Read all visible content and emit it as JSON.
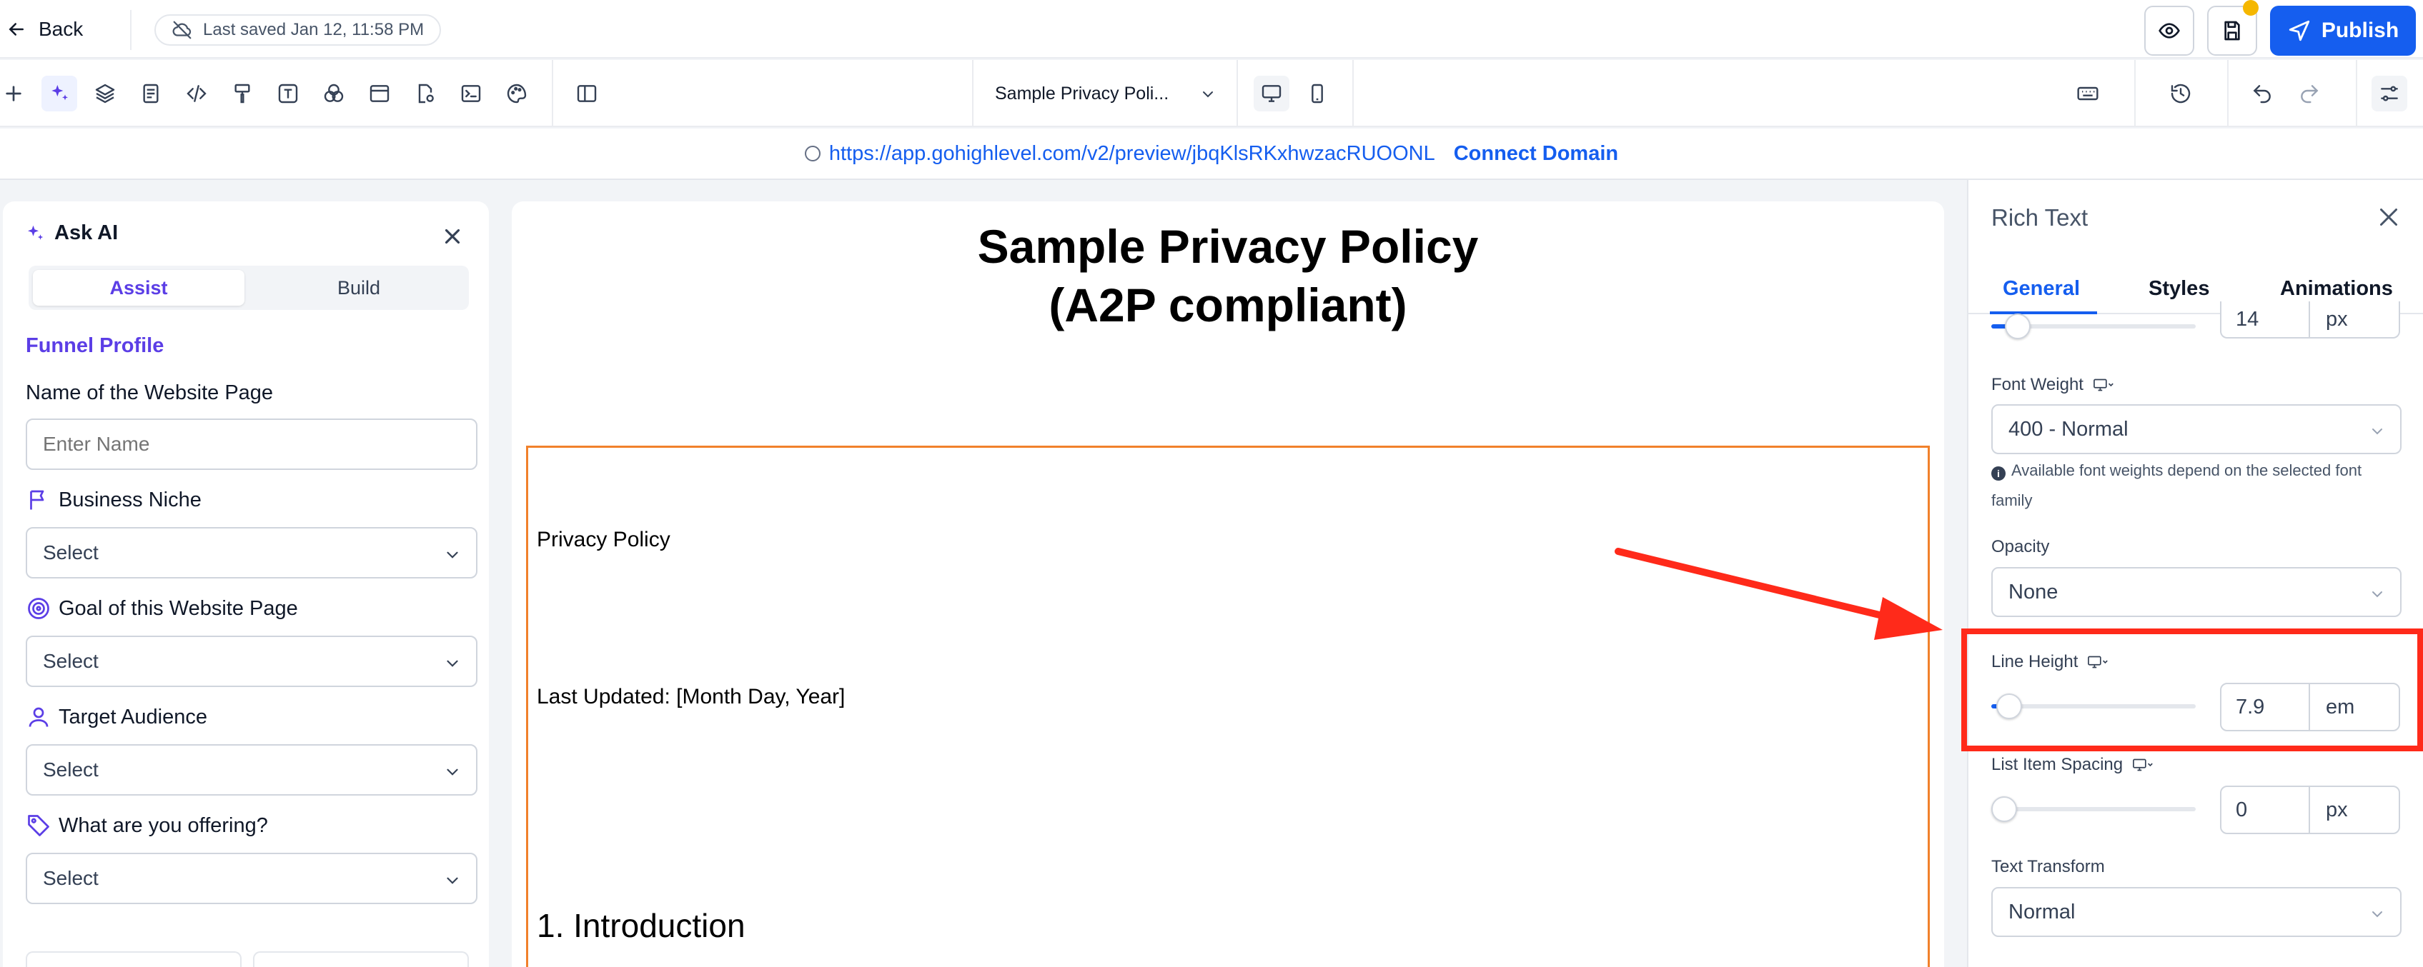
{
  "topbar": {
    "back_label": "Back",
    "saved_label": "Last saved Jan 12, 11:58 PM",
    "publish_label": "Publish"
  },
  "toolbar": {
    "page_select": "Sample Privacy Poli...",
    "tools": [
      "plus-icon",
      "ai-sparkle-icon",
      "layers-icon",
      "page-icon",
      "code-icon",
      "paint-icon",
      "text-icon",
      "colors-icon",
      "section-icon",
      "page-settings-icon",
      "terminal-icon",
      "palette-icon",
      "split-view-icon"
    ]
  },
  "urlbar": {
    "url": "https://app.gohighlevel.com/v2/preview/jbqKlsRKxhwzacRUOONL",
    "connect_label": "Connect Domain"
  },
  "ai_panel": {
    "title": "Ask AI",
    "tabs": [
      "Assist",
      "Build"
    ],
    "active_tab": "Assist",
    "section_title": "Funnel Profile",
    "fields": [
      {
        "label": "Name of the Website Page",
        "placeholder": "Enter Name",
        "icon": ""
      },
      {
        "label": "Business Niche",
        "value": "Select",
        "icon": "flag-icon"
      },
      {
        "label": "Goal of this Website Page",
        "value": "Select",
        "icon": "target-icon"
      },
      {
        "label": "Target Audience",
        "value": "Select",
        "icon": "user-icon"
      },
      {
        "label": "What are you offering?",
        "value": "Select",
        "icon": "tag-icon"
      }
    ]
  },
  "canvas": {
    "title_line1": "Sample Privacy Policy",
    "title_line2": "(A2P compliant)",
    "lines": [
      "Privacy Policy",
      "Last Updated: [Month Day, Year]",
      "1. Introduction"
    ]
  },
  "right_panel": {
    "title": "Rich Text",
    "tabs": [
      "General",
      "Styles",
      "Animations"
    ],
    "active_tab": "General",
    "font_size": {
      "value": "14",
      "unit": "px",
      "level": 0.08
    },
    "font_weight": {
      "label": "Font Weight",
      "value": "400 - Normal",
      "note": "Available font weights depend on the selected font family"
    },
    "opacity": {
      "label": "Opacity",
      "value": "None"
    },
    "line_height": {
      "label": "Line Height",
      "value": "7.9",
      "unit": "em",
      "level": 0.04
    },
    "list_item_spacing": {
      "label": "List Item Spacing",
      "value": "0",
      "unit": "px",
      "level": 0.0
    },
    "text_transform": {
      "label": "Text Transform",
      "value": "Normal"
    }
  },
  "colors": {
    "accent": "#155eef",
    "ai_purple": "#5b3ee6",
    "highlight": "#ff2a1a",
    "selection": "#f1812b"
  }
}
